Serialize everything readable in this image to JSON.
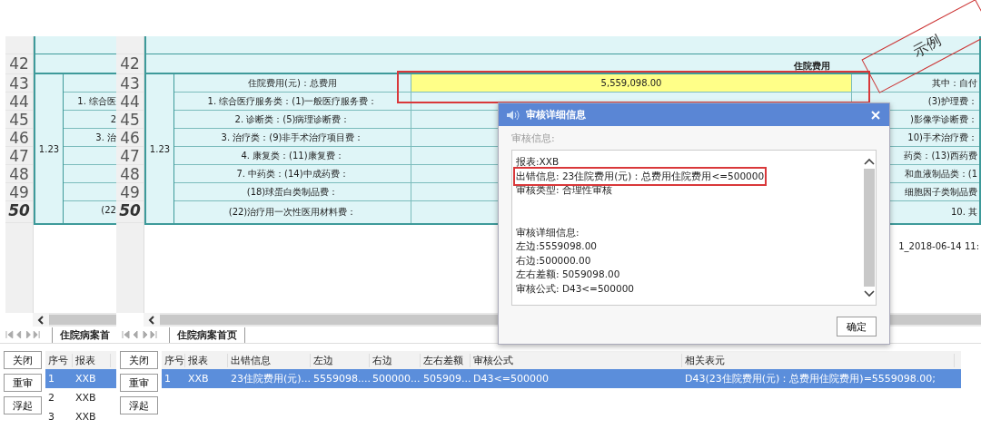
{
  "back_window": {
    "sheet": {
      "group": "1.23",
      "rows": [
        {
          "number": "42",
          "selected": false
        },
        {
          "number": "43",
          "selected": false
        },
        {
          "number": "44",
          "selected": false,
          "text": "1. 综合医"
        },
        {
          "number": "45",
          "selected": false,
          "text": "2"
        },
        {
          "number": "46",
          "selected": false,
          "text": "3. 治"
        },
        {
          "number": "47",
          "selected": false
        },
        {
          "number": "48",
          "selected": false
        },
        {
          "number": "49",
          "selected": false
        },
        {
          "number": "50",
          "selected": true,
          "text": "(22"
        }
      ]
    },
    "sheet_tab": "住院病案首",
    "buttons": [
      "关闭",
      "重审",
      "浮起"
    ],
    "table": {
      "columns": [
        "序号",
        "报表"
      ],
      "rows": [
        {
          "cells": [
            "1",
            "XXB"
          ],
          "selected": true
        },
        {
          "cells": [
            "2",
            "XXB"
          ],
          "selected": false
        },
        {
          "cells": [
            "3",
            "XXB"
          ],
          "selected": false
        }
      ]
    }
  },
  "front_window": {
    "sheet": {
      "section_header": "住院费用",
      "group": "1.23",
      "rows": [
        {
          "number": "42",
          "selected": false
        },
        {
          "number": "43",
          "selected": false,
          "label": "住院费用(元)：总费用",
          "value": "5,559,098.00",
          "right": "其中：自付"
        },
        {
          "number": "44",
          "selected": false,
          "label": "1. 综合医疗服务类：(1)一般医疗服务费：",
          "right": "(3)护理费："
        },
        {
          "number": "45",
          "selected": false,
          "label": "2. 诊断类：(5)病理诊断费：",
          "right": ")影像学诊断费："
        },
        {
          "number": "46",
          "selected": false,
          "label": "3. 治疗类：(9)非手术治疗项目费：",
          "right": "10)手术治疗费："
        },
        {
          "number": "47",
          "selected": false,
          "label": "4. 康复类：(11)康复费：",
          "right": "药类：(13)西药费"
        },
        {
          "number": "48",
          "selected": false,
          "label": "7. 中药类：(14)中成药费：",
          "right": "和血液制品类：(1"
        },
        {
          "number": "49",
          "selected": false,
          "label": "(18)球蛋白类制品费：",
          "right": "细胞因子类制品费"
        },
        {
          "number": "50",
          "selected": true,
          "label": "(22)治疗用一次性医用材料费：",
          "right": "10. 其"
        }
      ]
    },
    "timestamp": "1_2018-06-14 11:",
    "sheet_tab": "住院病案首页",
    "buttons": [
      "关闭",
      "重审",
      "浮起"
    ],
    "table": {
      "columns": [
        "序号",
        "报表",
        "出错信息",
        "左边",
        "右边",
        "左右差额",
        "审核公式",
        "相关表元"
      ],
      "rows": [
        {
          "cells": [
            "1",
            "XXB",
            "23住院费用(元)...",
            "5559098....",
            "500000...",
            "505909...",
            "D43<=500000",
            "D43(23住院费用(元)：总费用住院费用)=5559098.00;"
          ],
          "selected": true
        }
      ]
    }
  },
  "dialog": {
    "title": "审核详细信息",
    "section_label": "审核信息:",
    "lines": [
      {
        "text": "报表:XXB",
        "gap_before": false,
        "highlighted": false
      },
      {
        "text": "出错信息: 23住院费用(元)：总费用住院费用<=500000",
        "gap_before": false,
        "highlighted": true
      },
      {
        "text": "审核类型: 合理性审核",
        "gap_before": false,
        "highlighted": false
      },
      {
        "text": "审核详细信息:",
        "gap_before": true,
        "highlighted": false
      },
      {
        "text": "左边:5559098.00",
        "gap_before": false,
        "highlighted": false
      },
      {
        "text": "右边:500000.00",
        "gap_before": false,
        "highlighted": false
      },
      {
        "text": "左右差额: 5059098.00",
        "gap_before": false,
        "highlighted": false
      },
      {
        "text": "审核公式: D43<=500000",
        "gap_before": false,
        "highlighted": false
      }
    ],
    "ok_button": "确定"
  },
  "stamp": "示例"
}
